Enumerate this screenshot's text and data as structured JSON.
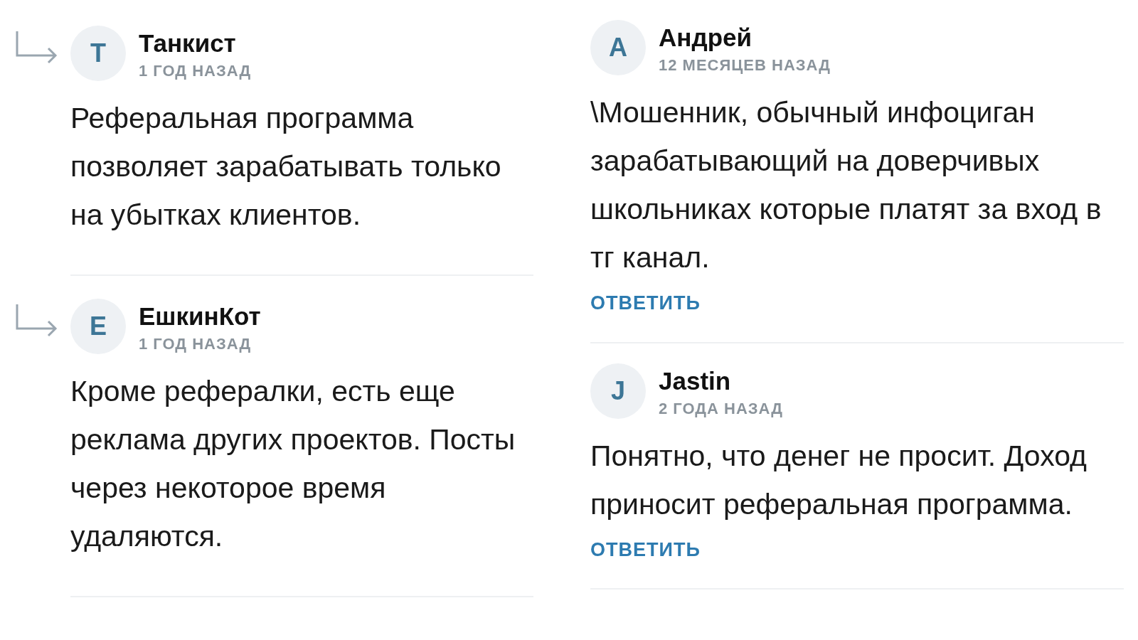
{
  "columns": [
    {
      "comments": [
        {
          "reply": true,
          "initial": "Т",
          "author": "Танкист",
          "date": "1 ГОД НАЗАД",
          "text": "Реферальная программа позволяет зарабатывать только на убытках клиентов."
        },
        {
          "reply": true,
          "initial": "Е",
          "author": "ЕшкинКот",
          "date": "1 ГОД НАЗАД",
          "text": "Кроме рефералки, есть еще реклама других проектов. Посты через некоторое время удаляются."
        }
      ]
    },
    {
      "comments": [
        {
          "reply": false,
          "initial": "А",
          "author": "Андрей",
          "date": "12 МЕСЯЦЕВ НАЗАД",
          "text": "\\Мошенник, обычный инфоциган зарабатывающий на доверчивых школьниках которые платят за вход в тг канал.",
          "action": "ОТВЕТИТЬ"
        },
        {
          "reply": false,
          "initial": "J",
          "author": "Jastin",
          "date": "2 ГОДА НАЗАД",
          "text": "Понятно, что денег не просит. Доход приносит реферальная программа.",
          "action": "ОТВЕТИТЬ"
        }
      ]
    }
  ]
}
